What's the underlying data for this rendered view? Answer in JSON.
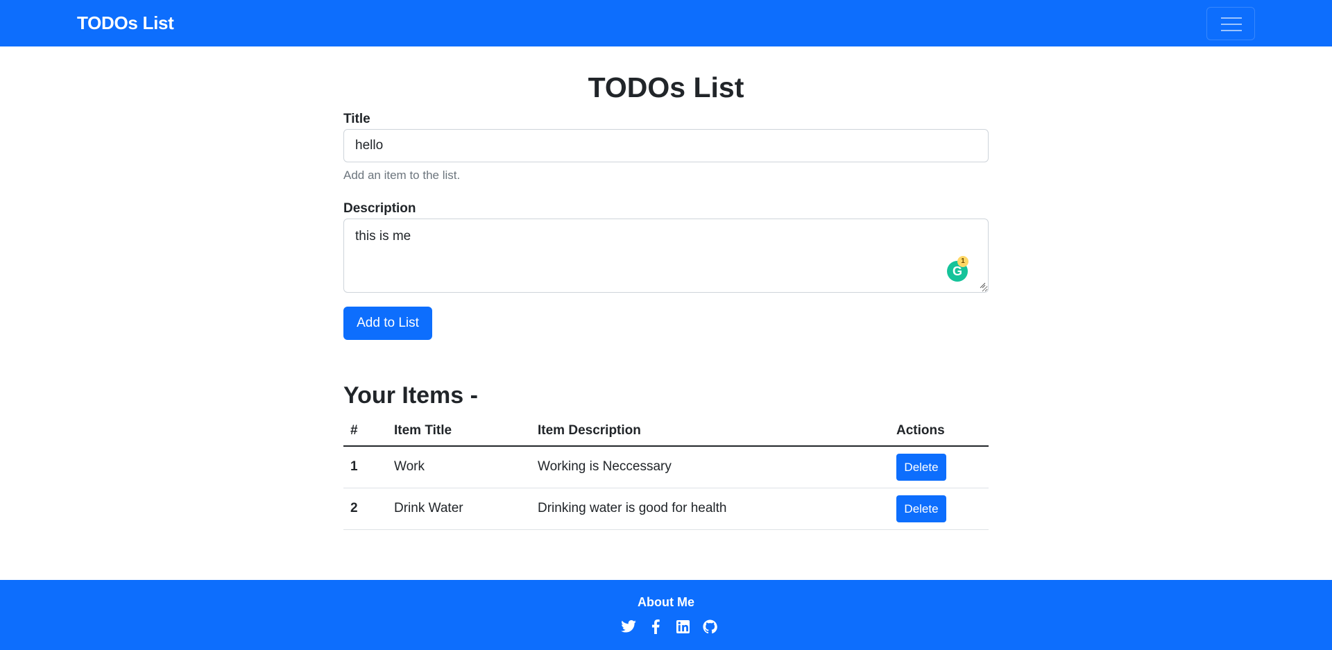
{
  "navbar": {
    "brand": "TODOs List"
  },
  "page": {
    "title": "TODOs List"
  },
  "form": {
    "title_label": "Title",
    "title_value": "hello",
    "title_help": "Add an item to the list.",
    "description_label": "Description",
    "description_value": "this is me",
    "grammarly_icon_letter": "G",
    "grammarly_count": "1",
    "submit_label": "Add to List"
  },
  "items": {
    "heading": "Your Items -",
    "columns": [
      "#",
      "Item Title",
      "Item Description",
      "Actions"
    ],
    "rows": [
      {
        "num": "1",
        "title": "Work",
        "description": "Working is Neccessary",
        "action": "Delete"
      },
      {
        "num": "2",
        "title": "Drink Water",
        "description": "Drinking water is good for health",
        "action": "Delete"
      }
    ]
  },
  "footer": {
    "title": "About Me",
    "socials": [
      "twitter-icon",
      "facebook-icon",
      "linkedin-icon",
      "github-icon"
    ]
  },
  "colors": {
    "primary": "#0d6efd",
    "text": "#212529",
    "muted": "#6c757d"
  }
}
